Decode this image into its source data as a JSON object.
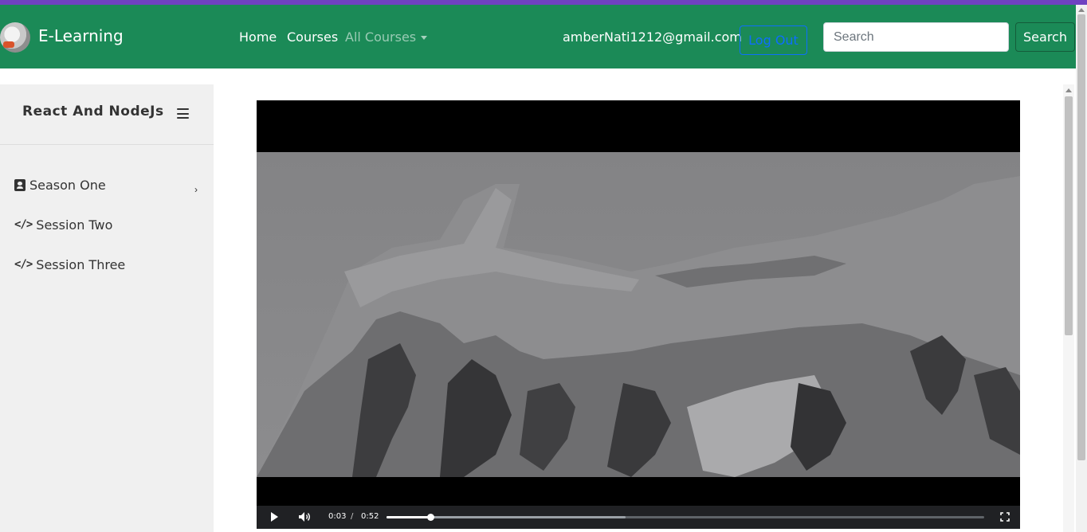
{
  "navbar": {
    "brand": "E-Learning",
    "links": [
      "Home",
      "Courses",
      "All Courses"
    ],
    "user_email": "amberNati1212@gmail.com",
    "logout_label": "Log Out",
    "search_placeholder": "Search",
    "search_button": "Search",
    "bg_color": "#1b8a57",
    "logout_color": "#0d6efd"
  },
  "sidebar": {
    "course_title": "React And NodeJs",
    "items": [
      {
        "label": "Season One",
        "icon": "contact-book-icon",
        "has_submenu": true
      },
      {
        "label": "Session Two",
        "icon": "code-icon",
        "has_submenu": false
      },
      {
        "label": "Session Three",
        "icon": "code-icon",
        "has_submenu": false
      }
    ]
  },
  "video": {
    "current_time": "0:03",
    "separator": "/",
    "duration": "0:52",
    "progress_fraction": 0.073,
    "buffered_fraction": 0.4
  }
}
